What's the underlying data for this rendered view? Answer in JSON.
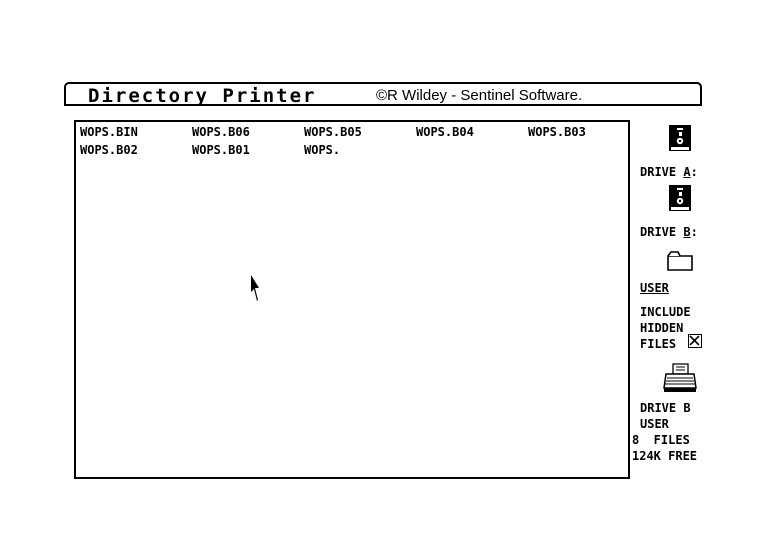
{
  "title": {
    "app_name": "Directory Printer",
    "credit": "©R Wildey - Sentinel Software."
  },
  "files": [
    "WOPS.BIN",
    "WOPS.B06",
    "WOPS.B05",
    "WOPS.B04",
    "WOPS.B03",
    "WOPS.B02",
    "WOPS.B01",
    "WOPS."
  ],
  "sidebar": {
    "drive_a": {
      "prefix": "DRIVE ",
      "key": "A",
      "suffix": ":",
      "icon": "floppy-disk-icon"
    },
    "drive_b": {
      "prefix": "DRIVE ",
      "key": "B",
      "suffix": ":",
      "icon": "floppy-disk-icon"
    },
    "user": {
      "label": "USER",
      "icon": "folder-icon"
    },
    "include_hidden": {
      "line1": "INCLUDE",
      "line2": "HIDDEN",
      "line3": "FILES",
      "checked": true
    },
    "printer": {
      "icon": "printer-icon"
    }
  },
  "status": {
    "drive": "DRIVE B",
    "user": "USER",
    "files": "8  FILES",
    "free": "124K FREE"
  }
}
